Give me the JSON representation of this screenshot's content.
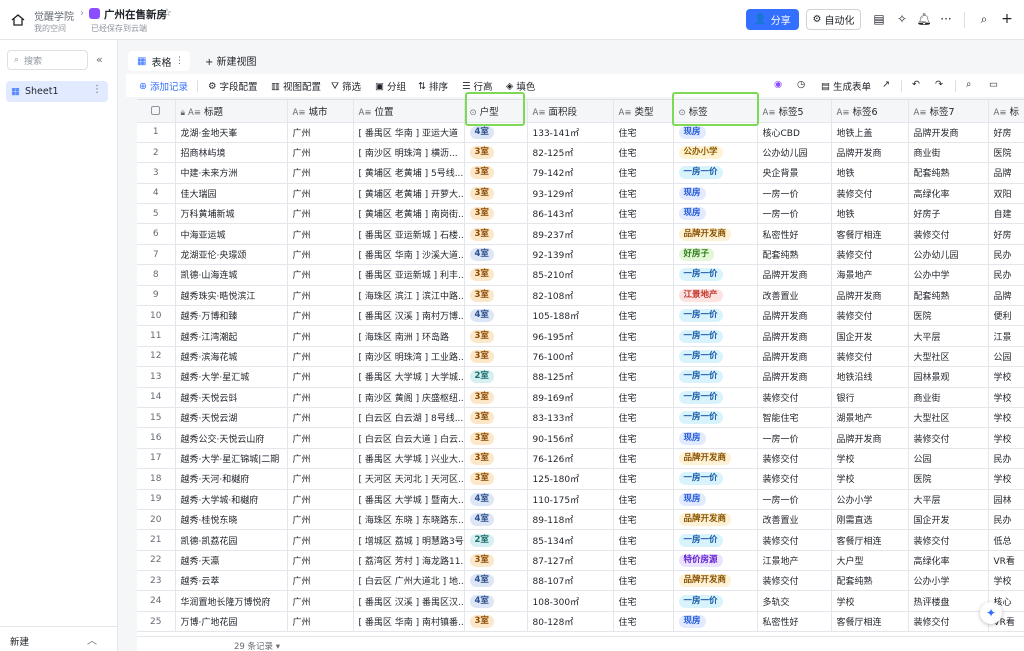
{
  "header": {
    "space": "觉醒学院",
    "doc_title": "广州在售新房",
    "space_sub": "我的空间",
    "save_status": "已经保存到云端",
    "share_label": "分享",
    "auto_label": "自动化"
  },
  "sidebar": {
    "search_placeholder": "搜索",
    "sheet_name": "Sheet1",
    "new_label": "新建"
  },
  "views": {
    "active_tab": "表格",
    "new_view": "+ 新建视图"
  },
  "toolbar": {
    "add_record": "添加记录",
    "field_config": "字段配置",
    "view_config": "视图配置",
    "filter": "筛选",
    "group": "分组",
    "sort": "排序",
    "row_height": "行高",
    "fill_color": "填色",
    "gen_form": "生成表单"
  },
  "columns": [
    "标题",
    "城市",
    "位置",
    "户型",
    "面积段",
    "类型",
    "标签",
    "标签5",
    "标签6",
    "标签7",
    "标"
  ],
  "rows": [
    {
      "n": "1",
      "t": "龙湖·金地天峯",
      "c": "广州",
      "p": "[ 番禺区 华南 ] 亚运大道",
      "h": "4室",
      "a": "133-141㎡",
      "k": "住宅",
      "g": "现房",
      "l5": "核心CBD",
      "l6": "地铁上盖",
      "l7": "品牌开发商",
      "l8": "好房"
    },
    {
      "n": "2",
      "t": "招商林屿境",
      "c": "广州",
      "p": "[ 南沙区 明珠湾 ] 横沥...",
      "h": "3室",
      "a": "82-125㎡",
      "k": "住宅",
      "g": "公办小学",
      "l5": "公办幼儿园",
      "l6": "品牌开发商",
      "l7": "商业街",
      "l8": "医院"
    },
    {
      "n": "3",
      "t": "中建·未来方洲",
      "c": "广州",
      "p": "[ 黄埔区 老黄埔 ] 5号线...",
      "h": "3室",
      "a": "79-142㎡",
      "k": "住宅",
      "g": "一房一价",
      "l5": "央企背景",
      "l6": "地铁",
      "l7": "配套纯熟",
      "l8": "品牌"
    },
    {
      "n": "4",
      "t": "佳大瑞园",
      "c": "广州",
      "p": "[ 黄埔区 老黄埔 ] 开萝大...",
      "h": "3室",
      "a": "93-129㎡",
      "k": "住宅",
      "g": "现房",
      "l5": "一房一价",
      "l6": "装修交付",
      "l7": "高绿化率",
      "l8": "双阳"
    },
    {
      "n": "5",
      "t": "万科黄埔新城",
      "c": "广州",
      "p": "[ 黄埔区 老黄埔 ] 南岗街...",
      "h": "3室",
      "a": "86-143㎡",
      "k": "住宅",
      "g": "现房",
      "l5": "一房一价",
      "l6": "地铁",
      "l7": "好房子",
      "l8": "自建"
    },
    {
      "n": "6",
      "t": "中海亚运城",
      "c": "广州",
      "p": "[ 番禺区 亚运新城 ] 石楼...",
      "h": "3室",
      "a": "89-237㎡",
      "k": "住宅",
      "g": "品牌开发商",
      "l5": "私密性好",
      "l6": "客餐厅相连",
      "l7": "装修交付",
      "l8": "好房"
    },
    {
      "n": "7",
      "t": "龙湖亚伦·央璟颂",
      "c": "广州",
      "p": "[ 番禺区 华南 ] 沙溪大道...",
      "h": "4室",
      "a": "92-139㎡",
      "k": "住宅",
      "g": "好房子",
      "l5": "配套纯熟",
      "l6": "装修交付",
      "l7": "公办幼儿园",
      "l8": "民办"
    },
    {
      "n": "8",
      "t": "凯德·山海连城",
      "c": "广州",
      "p": "[ 番禺区 亚运新城 ] 利丰...",
      "h": "3室",
      "a": "85-210㎡",
      "k": "住宅",
      "g": "一房一价",
      "l5": "品牌开发商",
      "l6": "海景地产",
      "l7": "公办中学",
      "l8": "民办"
    },
    {
      "n": "9",
      "t": "越秀珠实·晧悦滨江",
      "c": "广州",
      "p": "[ 海珠区 滨江 ] 滨江中路...",
      "h": "3室",
      "a": "82-108㎡",
      "k": "住宅",
      "g": "江景地产",
      "l5": "改善置业",
      "l6": "品牌开发商",
      "l7": "配套纯熟",
      "l8": "品牌"
    },
    {
      "n": "10",
      "t": "越秀·万博和臻",
      "c": "广州",
      "p": "[ 番禺区 汉溪 ] 南村万博...",
      "h": "4室",
      "a": "105-188㎡",
      "k": "住宅",
      "g": "一房一价",
      "l5": "品牌开发商",
      "l6": "装修交付",
      "l7": "医院",
      "l8": "便利"
    },
    {
      "n": "11",
      "t": "越秀·江湾潮起",
      "c": "广州",
      "p": "[ 海珠区 南洲 ] 环岛路",
      "h": "3室",
      "a": "96-195㎡",
      "k": "住宅",
      "g": "一房一价",
      "l5": "品牌开发商",
      "l6": "国企开发",
      "l7": "大平层",
      "l8": "江景"
    },
    {
      "n": "12",
      "t": "越秀·滨海花城",
      "c": "广州",
      "p": "[ 南沙区 明珠湾 ] 工业路...",
      "h": "3室",
      "a": "76-100㎡",
      "k": "住宅",
      "g": "一房一价",
      "l5": "品牌开发商",
      "l6": "装修交付",
      "l7": "大型社区",
      "l8": "公园"
    },
    {
      "n": "13",
      "t": "越秀·大学·星汇城",
      "c": "广州",
      "p": "[ 番禺区 大学城 ] 大学城...",
      "h": "2室",
      "a": "88-125㎡",
      "k": "住宅",
      "g": "一房一价",
      "l5": "品牌开发商",
      "l6": "地铁沿线",
      "l7": "园林景观",
      "l8": "学校"
    },
    {
      "n": "14",
      "t": "越秀·天悦云㪷",
      "c": "广州",
      "p": "[ 南沙区 黄阁 ] 庆盛枢纽...",
      "h": "3室",
      "a": "89-169㎡",
      "k": "住宅",
      "g": "一房一价",
      "l5": "装修交付",
      "l6": "银行",
      "l7": "商业街",
      "l8": "学校"
    },
    {
      "n": "15",
      "t": "越秀·天悦云湖",
      "c": "广州",
      "p": "[ 白云区 白云湖 ] 8号线...",
      "h": "3室",
      "a": "83-133㎡",
      "k": "住宅",
      "g": "一房一价",
      "l5": "智能住宅",
      "l6": "湖景地产",
      "l7": "大型社区",
      "l8": "学校"
    },
    {
      "n": "16",
      "t": "越秀公交·天悦云山府",
      "c": "广州",
      "p": "[ 白云区 白云大道 ] 白云...",
      "h": "3室",
      "a": "90-156㎡",
      "k": "住宅",
      "g": "现房",
      "l5": "一房一价",
      "l6": "品牌开发商",
      "l7": "装修交付",
      "l8": "学校"
    },
    {
      "n": "17",
      "t": "越秀·大学·星汇锦城|二期",
      "c": "广州",
      "p": "[ 番禺区 大学城 ] 兴业大...",
      "h": "3室",
      "a": "76-126㎡",
      "k": "住宅",
      "g": "品牌开发商",
      "l5": "装修交付",
      "l6": "学校",
      "l7": "公园",
      "l8": "民办"
    },
    {
      "n": "18",
      "t": "越秀·天河·和樾府",
      "c": "广州",
      "p": "[ 天河区 天河北 ] 天河区...",
      "h": "3室",
      "a": "125-180㎡",
      "k": "住宅",
      "g": "一房一价",
      "l5": "装修交付",
      "l6": "学校",
      "l7": "医院",
      "l8": "学校"
    },
    {
      "n": "19",
      "t": "越秀·大学城·和樾府",
      "c": "广州",
      "p": "[ 番禺区 大学城 ] 暨南大...",
      "h": "4室",
      "a": "110-175㎡",
      "k": "住宅",
      "g": "现房",
      "l5": "一房一价",
      "l6": "公办小学",
      "l7": "大平层",
      "l8": "园林"
    },
    {
      "n": "20",
      "t": "越秀·桂悦东晓",
      "c": "广州",
      "p": "[ 海珠区 东晓 ] 东晓路东...",
      "h": "4室",
      "a": "89-118㎡",
      "k": "住宅",
      "g": "品牌开发商",
      "l5": "改善置业",
      "l6": "刚需直选",
      "l7": "国企开发",
      "l8": "民办"
    },
    {
      "n": "21",
      "t": "凯德·凯荔花园",
      "c": "广州",
      "p": "[ 增城区 荔城 ] 明慧路3号",
      "h": "2室",
      "a": "85-134㎡",
      "k": "住宅",
      "g": "一房一价",
      "l5": "装修交付",
      "l6": "客餐厅相连",
      "l7": "装修交付",
      "l8": "低总"
    },
    {
      "n": "22",
      "t": "越秀·天瀛",
      "c": "广州",
      "p": "[ 荔湾区 芳村 ] 海龙路11...",
      "h": "3室",
      "a": "87-127㎡",
      "k": "住宅",
      "g": "特价房源",
      "l5": "江景地产",
      "l6": "大户型",
      "l7": "高绿化率",
      "l8": "VR看"
    },
    {
      "n": "23",
      "t": "越秀·云萃",
      "c": "广州",
      "p": "[ 白云区 广州大道北 ] 地...",
      "h": "4室",
      "a": "88-107㎡",
      "k": "住宅",
      "g": "品牌开发商",
      "l5": "装修交付",
      "l6": "配套纯熟",
      "l7": "公办小学",
      "l8": "学校"
    },
    {
      "n": "24",
      "t": "华润置地长隆万博悦府",
      "c": "广州",
      "p": "[ 番禺区 汉溪 ] 番禺区汉...",
      "h": "4室",
      "a": "108-300㎡",
      "k": "住宅",
      "g": "一房一价",
      "l5": "多轨交",
      "l6": "学校",
      "l7": "热评楼盘",
      "l8": "核心"
    },
    {
      "n": "25",
      "t": "万博·广地花园",
      "c": "广州",
      "p": "[ 番禺区 华南 ] 南村镇番...",
      "h": "3室",
      "a": "80-128㎡",
      "k": "住宅",
      "g": "现房",
      "l5": "私密性好",
      "l6": "客餐厅相连",
      "l7": "装修交付",
      "l8": "VR看"
    }
  ],
  "tag_colors": {
    "现房": {
      "bg": "#e1eaff",
      "fg": "#245bdb"
    },
    "公办小学": {
      "bg": "#fff3d1",
      "fg": "#8f5a00"
    },
    "一房一价": {
      "bg": "#d9f3fd",
      "fg": "#1d5ea8"
    },
    "品牌开发商": {
      "bg": "#fdf1d6",
      "fg": "#8a5300"
    },
    "好房子": {
      "bg": "#e3f6d6",
      "fg": "#2e7d1c"
    },
    "江景地产": {
      "bg": "#fde2e2",
      "fg": "#c0392b"
    },
    "特价房源": {
      "bg": "#ece2fe",
      "fg": "#6425d0"
    }
  },
  "room_colors": {
    "4室": {
      "bg": "#dce6f7",
      "fg": "#2b4f8c"
    },
    "3室": {
      "bg": "#fde7c9",
      "fg": "#8a4b00"
    },
    "2室": {
      "bg": "#d4f0f0",
      "fg": "#1a6b6b"
    }
  },
  "footer": {
    "record_count": "29 条记录 ▾"
  },
  "accent": "#3370ff"
}
